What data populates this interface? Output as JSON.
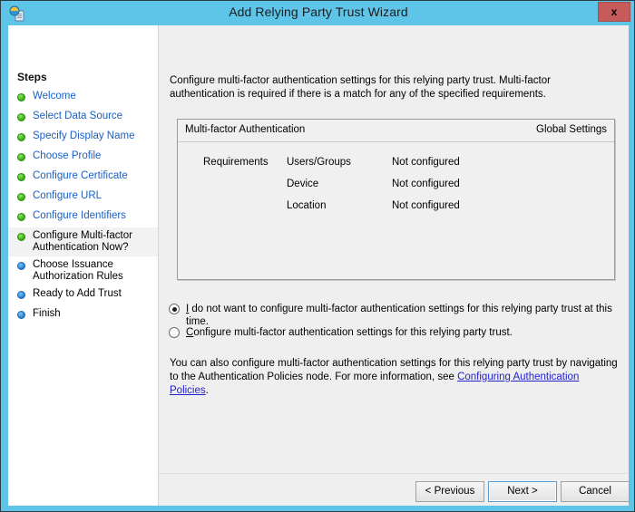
{
  "window": {
    "title": "Add Relying Party Trust Wizard",
    "icon": "relying-party-trust-icon",
    "close_label": "x",
    "accent_color": "#5fc5e8",
    "close_color": "#c75b5b"
  },
  "sidebar": {
    "heading": "Steps",
    "items": [
      {
        "label": "Welcome",
        "state": "done"
      },
      {
        "label": "Select Data Source",
        "state": "done"
      },
      {
        "label": "Specify Display Name",
        "state": "done"
      },
      {
        "label": "Choose Profile",
        "state": "done"
      },
      {
        "label": "Configure Certificate",
        "state": "done"
      },
      {
        "label": "Configure URL",
        "state": "done"
      },
      {
        "label": "Configure Identifiers",
        "state": "done"
      },
      {
        "label": "Configure Multi-factor Authentication Now?",
        "state": "current"
      },
      {
        "label": "Choose Issuance Authorization Rules",
        "state": "pending"
      },
      {
        "label": "Ready to Add Trust",
        "state": "pending"
      },
      {
        "label": "Finish",
        "state": "pending"
      }
    ]
  },
  "main": {
    "intro": "Configure multi-factor authentication settings for this relying party trust. Multi-factor authentication is required if there is a match for any of the specified requirements.",
    "panel": {
      "title": "Multi-factor Authentication",
      "scope": "Global Settings",
      "requirements_label": "Requirements",
      "rows": [
        {
          "name": "Users/Groups",
          "value": "Not configured"
        },
        {
          "name": "Device",
          "value": "Not configured"
        },
        {
          "name": "Location",
          "value": "Not configured"
        }
      ]
    },
    "options": [
      {
        "accelerator": "I",
        "text": " do not want to configure multi-factor authentication settings for this relying party trust at this time.",
        "selected": true
      },
      {
        "accelerator": "C",
        "text": "onfigure multi-factor authentication settings for this relying party trust.",
        "selected": false
      }
    ],
    "note": {
      "text_before": "You can also configure multi-factor authentication settings for this relying party trust by navigating to the Authentication Policies node. For more information, see ",
      "link": "Configuring Authentication Policies",
      "text_after": ".",
      "link_color": "#2222cc"
    }
  },
  "footer": {
    "previous_label": "< Previous",
    "next_label": "Next >",
    "cancel_label": "Cancel"
  }
}
